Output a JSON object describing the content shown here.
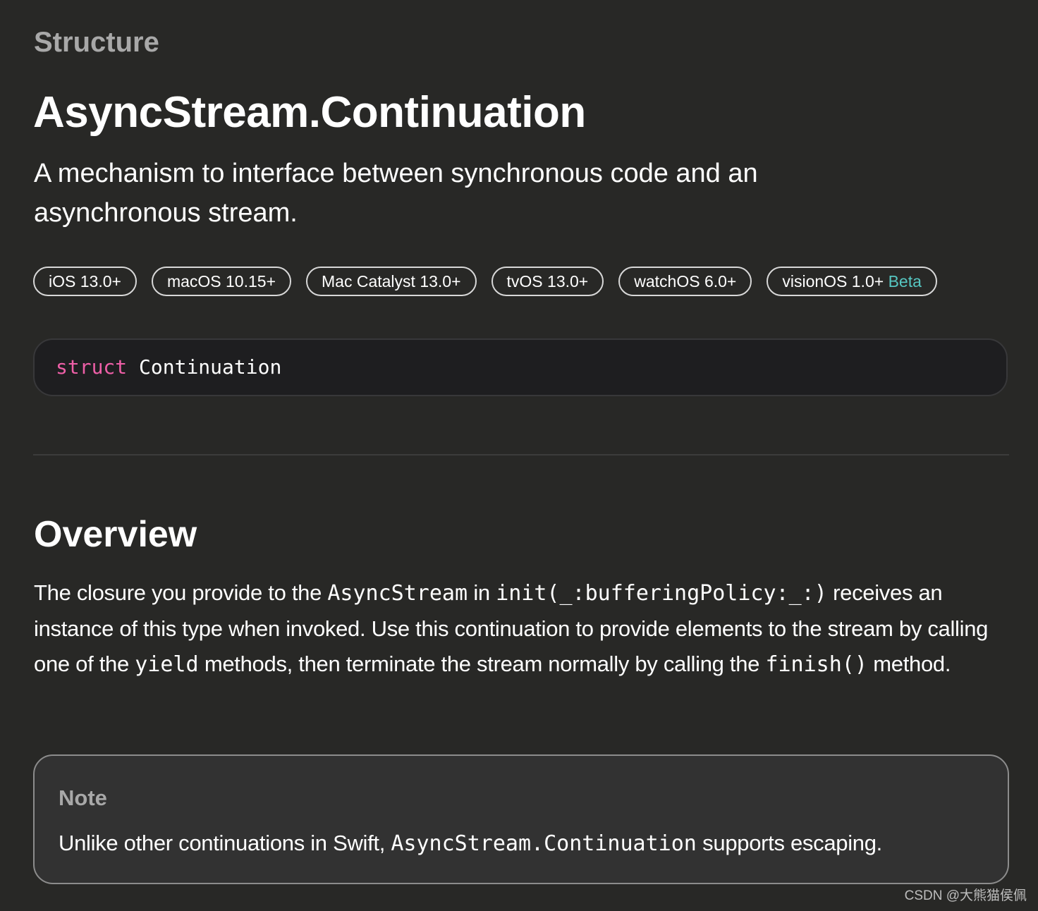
{
  "page": {
    "eyebrow": "Structure",
    "title": "AsyncStream.Continuation",
    "abstract": "A mechanism to interface between synchronous code and an asynchronous stream."
  },
  "platforms": [
    {
      "label": "iOS 13.0+"
    },
    {
      "label": "macOS 10.15+"
    },
    {
      "label": "Mac Catalyst 13.0+"
    },
    {
      "label": "tvOS 13.0+"
    },
    {
      "label": "watchOS 6.0+"
    },
    {
      "label": "visionOS 1.0+",
      "beta": "Beta"
    }
  ],
  "declaration": {
    "keyword": "struct",
    "name": "Continuation"
  },
  "overview": {
    "heading": "Overview",
    "t1": "The closure you provide to the ",
    "c1": "AsyncStream",
    "t2": " in ",
    "c2": "init(_:bufferingPolicy:_:)",
    "t3": " receives an instance of this type when invoked. Use this continuation to provide elements to the stream by calling one of the ",
    "c3": "yield",
    "t4": " methods, then terminate the stream normally by calling the ",
    "c4": "finish()",
    "t5": " method."
  },
  "note": {
    "title": "Note",
    "t1": "Unlike other continuations in Swift, ",
    "c1": "AsyncStream.Continuation",
    "t2": " supports escaping."
  },
  "watermark": "CSDN @大熊猫侯佩",
  "colors": {
    "background": "#282826",
    "keyword": "#ee5fa7",
    "beta": "#56c6c1",
    "muted": "#a8a8a8"
  }
}
